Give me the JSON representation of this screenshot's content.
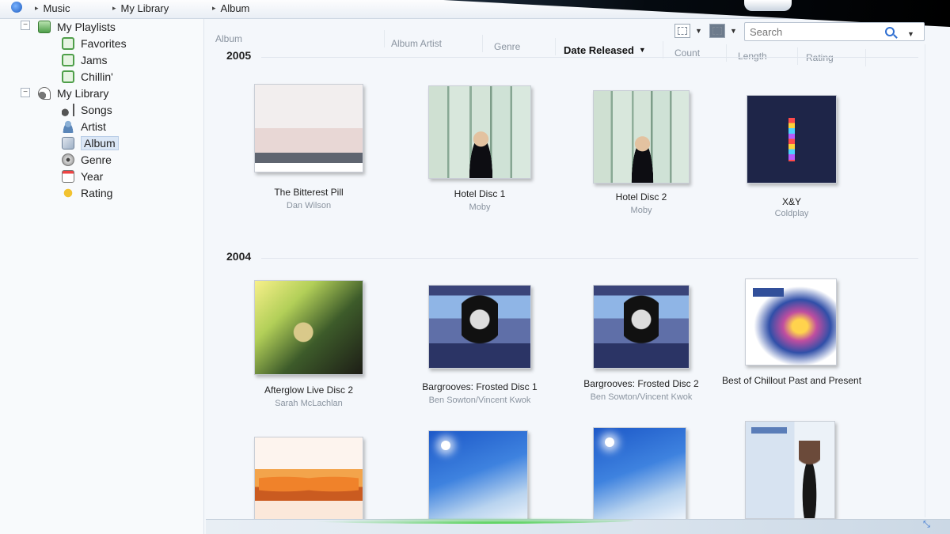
{
  "breadcrumb": {
    "items": [
      "Music",
      "My Library",
      "Album"
    ]
  },
  "search": {
    "placeholder": "Search"
  },
  "nav": {
    "playlists": {
      "label": "My Playlists",
      "items": [
        "Favorites",
        "Jams",
        "Chillin'"
      ]
    },
    "library": {
      "label": "My Library",
      "items": [
        "Songs",
        "Artist",
        "Album",
        "Genre",
        "Year",
        "Rating"
      ],
      "selected": "Album"
    }
  },
  "columns": [
    "Album",
    "Album Artist",
    "Genre",
    "Date Released",
    "Count",
    "Length",
    "Rating"
  ],
  "sorted_column": "Date Released",
  "groups": [
    {
      "year": "2005",
      "albums": [
        {
          "title": "The Bitterest Pill",
          "artist": "Dan Wilson",
          "art": "bitterest"
        },
        {
          "title": "Hotel Disc 1",
          "artist": "Moby",
          "art": "hotel"
        },
        {
          "title": "Hotel Disc 2",
          "artist": "Moby",
          "art": "hotel"
        },
        {
          "title": "X&Y",
          "artist": "Coldplay",
          "art": "xy"
        }
      ]
    },
    {
      "year": "2004",
      "albums": [
        {
          "title": "Afterglow Live Disc 2",
          "artist": "Sarah McLachlan",
          "art": "afterglow"
        },
        {
          "title": "Bargrooves: Frosted Disc 1",
          "artist": "Ben Sowton/Vincent Kwok",
          "art": "bargrooves"
        },
        {
          "title": "Bargrooves: Frosted Disc 2",
          "artist": "Ben Sowton/Vincent Kwok",
          "art": "bargrooves"
        },
        {
          "title": "Best of Chillout Past and Present",
          "artist": "",
          "art": "chillout"
        }
      ]
    },
    {
      "year": "",
      "albums": [
        {
          "title": "",
          "artist": "",
          "art": "sunglasses"
        },
        {
          "title": "",
          "artist": "",
          "art": "sky"
        },
        {
          "title": "",
          "artist": "",
          "art": "sky"
        },
        {
          "title": "",
          "artist": "",
          "art": "woman"
        }
      ]
    }
  ],
  "icons": {
    "app": "media-player-icon",
    "view": "view-options-icon",
    "layout": "layout-icon",
    "search": "search-icon",
    "playlist": "playlist-icon",
    "library": "library-icon"
  },
  "colors": {
    "accent": "#2f6fd1",
    "selection": "#dbe7f6",
    "glow": "#3fcf3f"
  }
}
